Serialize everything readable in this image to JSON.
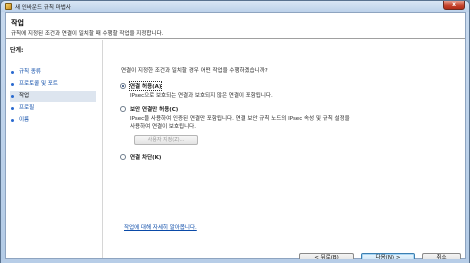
{
  "window": {
    "title": "새 인바운드 규칙 마법사",
    "close_glyph": "x"
  },
  "header": {
    "title": "작업",
    "subtitle": "규칙에 지정된 조건과 연결이 일치할 때 수행할 작업을 지정합니다."
  },
  "steps": {
    "heading": "단계:",
    "items": [
      {
        "label": "규칙 종류",
        "current": false
      },
      {
        "label": "프로토콜 및 포트",
        "current": false
      },
      {
        "label": "작업",
        "current": true
      },
      {
        "label": "프로필",
        "current": false
      },
      {
        "label": "이름",
        "current": false
      }
    ]
  },
  "main": {
    "question": "연결이 지정한 조건과 일치할 경우 어떤 작업을 수행하겠습니까?",
    "options": [
      {
        "label": "연결 허용(A)",
        "checked": true,
        "desc": [
          "IPsec으로 보호되는 연결과 보호되지 않은 연결이 포함됩니다."
        ]
      },
      {
        "label": "보안 연결만 허용(C)",
        "checked": false,
        "desc": [
          "IPsec을 사용하여 인증된 연결만 포함됩니다. 연결 보안 규칙 노드의 IPsec 속성 및 규칙 설정을",
          "사용하여 연결이 보호됩니다."
        ]
      },
      {
        "label": "연결 차단(K)",
        "checked": false,
        "desc": []
      }
    ],
    "customize_label": "사용자 지정(Z)...",
    "help_link": "작업에 대해 자세히 알아봅니다."
  },
  "buttons": {
    "back": "< 뒤로(B)",
    "next": "다음(N) >",
    "cancel": "취소"
  }
}
